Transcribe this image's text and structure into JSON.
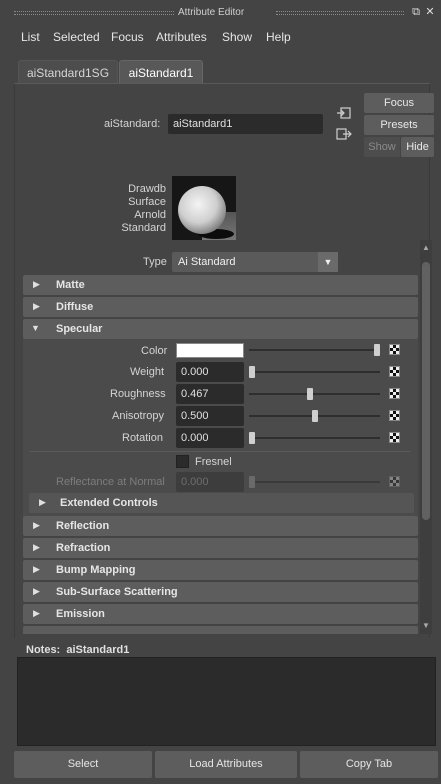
{
  "window": {
    "title": "Attribute Editor"
  },
  "menubar": [
    "List",
    "Selected",
    "Focus",
    "Attributes",
    "Show",
    "Help"
  ],
  "tabs": [
    {
      "label": "aiStandard1SG",
      "active": false
    },
    {
      "label": "aiStandard1",
      "active": true
    }
  ],
  "node": {
    "name_label": "aiStandard:",
    "name_value": "aiStandard1",
    "focus_button": "Focus",
    "presets_button": "Presets",
    "show_button": "Show",
    "hide_button": "Hide"
  },
  "swatch": {
    "caption": [
      "Drawdb",
      "Surface",
      "Arnold",
      "Standard"
    ]
  },
  "type": {
    "label": "Type",
    "value": "Ai Standard"
  },
  "sections_top": [
    {
      "name": "Matte",
      "expanded": false
    },
    {
      "name": "Diffuse",
      "expanded": false
    },
    {
      "name": "Specular",
      "expanded": true
    }
  ],
  "specular": {
    "color": {
      "label": "Color",
      "value": "#ffffff",
      "slider_level": 1.0
    },
    "weight": {
      "label": "Weight",
      "value": "0.000",
      "slider_level": 0.0
    },
    "roughness": {
      "label": "Roughness",
      "value": "0.467",
      "slider_level": 0.467
    },
    "anisotropy": {
      "label": "Anisotropy",
      "value": "0.500",
      "slider_level": 0.5
    },
    "rotation": {
      "label": "Rotation",
      "value": "0.000",
      "slider_level": 0.0
    },
    "fresnel": {
      "label": "Fresnel",
      "checked": false
    },
    "reflectance": {
      "label": "Reflectance at Normal",
      "value": "0.000",
      "slider_level": 0.0,
      "enabled": false
    },
    "extended": {
      "name": "Extended Controls",
      "expanded": false
    }
  },
  "sections_bottom": [
    {
      "name": "Reflection",
      "expanded": false
    },
    {
      "name": "Refraction",
      "expanded": false
    },
    {
      "name": "Bump Mapping",
      "expanded": false
    },
    {
      "name": "Sub-Surface Scattering",
      "expanded": false
    },
    {
      "name": "Emission",
      "expanded": false
    }
  ],
  "notes": {
    "label": "Notes:",
    "node": "aiStandard1",
    "text": ""
  },
  "bottom_buttons": {
    "select": "Select",
    "load": "Load Attributes",
    "copy": "Copy Tab"
  },
  "colors": {
    "panel_bg": "#444444",
    "section_bg": "#5d5d5d",
    "field_bg": "#2b2b2b"
  }
}
